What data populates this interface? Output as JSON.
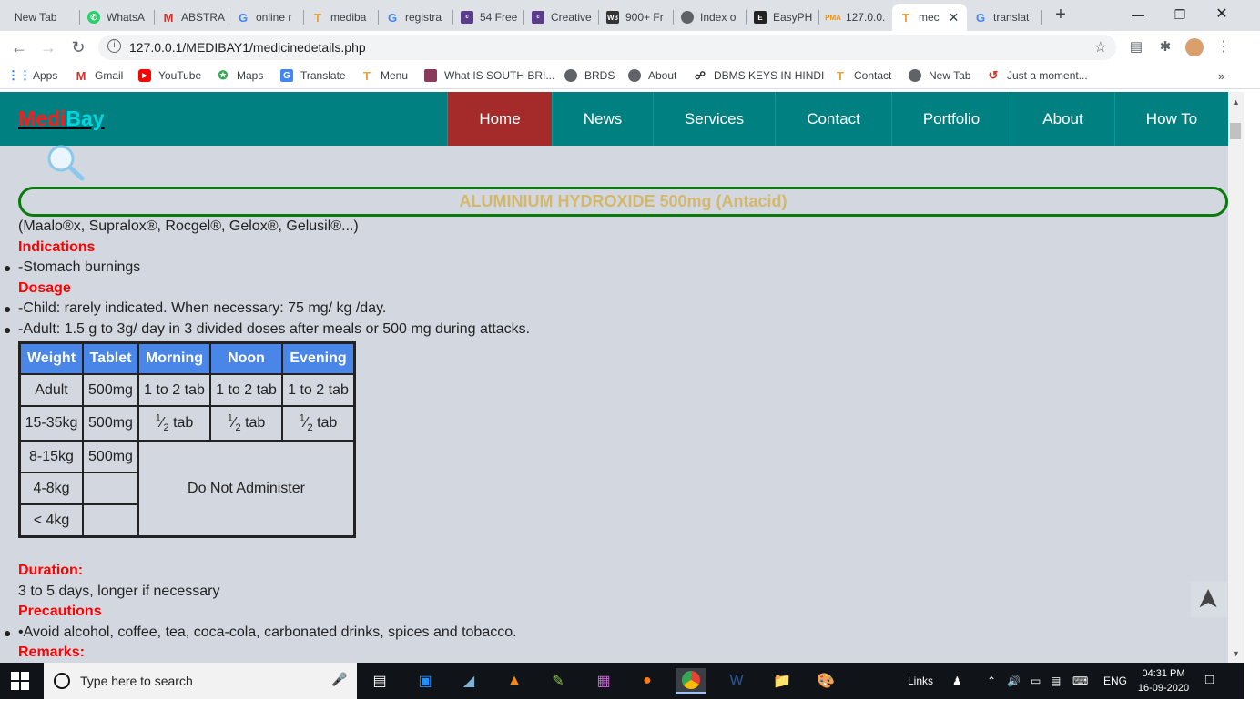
{
  "browser": {
    "tabs": [
      {
        "label": "New Tab",
        "icon": "none",
        "color": "#dee1e6"
      },
      {
        "label": "WhatsA",
        "icon": "whatsapp-icon",
        "color": "#25d366"
      },
      {
        "label": "ABSTRA",
        "icon": "gmail-icon",
        "color": "#d93025"
      },
      {
        "label": "online r",
        "icon": "google-icon",
        "color": "#4285f4"
      },
      {
        "label": "mediba",
        "icon": "medibay-icon",
        "color": "#e8a33d"
      },
      {
        "label": "registra",
        "icon": "google-icon",
        "color": "#4285f4"
      },
      {
        "label": "54 Free",
        "icon": "colorlib-icon",
        "color": "#5b3c8a"
      },
      {
        "label": "Creative",
        "icon": "colorlib-icon",
        "color": "#5b3c8a"
      },
      {
        "label": "900+ Fr",
        "icon": "w3-icon",
        "color": "#333"
      },
      {
        "label": "Index o",
        "icon": "globe-icon",
        "color": "#5f6368"
      },
      {
        "label": "EasyPH",
        "icon": "easyphp-icon",
        "color": "#222"
      },
      {
        "label": "127.0.0.",
        "icon": "pma-icon",
        "color": "#f29111"
      },
      {
        "label": "mec",
        "icon": "medibay-icon",
        "color": "#e8a33d"
      },
      {
        "label": "translat",
        "icon": "google-icon",
        "color": "#4285f4"
      }
    ],
    "new_tab_symbol": "+",
    "close_symbol": "✕",
    "url": "127.0.0.1/MEDIBAY1/medicinedetails.php",
    "bookmarks": [
      {
        "label": "Apps",
        "icon": "apps-grid-icon"
      },
      {
        "label": "Gmail",
        "icon": "gmail-icon"
      },
      {
        "label": "YouTube",
        "icon": "youtube-icon"
      },
      {
        "label": "Maps",
        "icon": "maps-icon"
      },
      {
        "label": "Translate",
        "icon": "translate-icon"
      },
      {
        "label": "Menu",
        "icon": "medibay-icon"
      },
      {
        "label": "What IS SOUTH BRI...",
        "icon": "page-icon"
      },
      {
        "label": "BRDS",
        "icon": "globe-icon"
      },
      {
        "label": "About",
        "icon": "globe-icon"
      },
      {
        "label": "DBMS KEYS IN HINDI",
        "icon": "page-icon"
      },
      {
        "label": "Contact",
        "icon": "medibay-icon"
      },
      {
        "label": "New Tab",
        "icon": "globe-icon"
      },
      {
        "label": "Just a moment...",
        "icon": "cloudflare-icon"
      }
    ],
    "bookmarks_overflow": "»"
  },
  "site": {
    "logo_part1": "Medi",
    "logo_part2": "Bay",
    "nav": [
      "Home",
      "News",
      "Services",
      "Contact",
      "Portfolio",
      "About",
      "How To"
    ],
    "active_nav": "Home",
    "colors": {
      "nav_bg": "#008080",
      "active_bg": "#a52a2a",
      "heading_red": "#ff0000",
      "table_header": "#4a86e8",
      "title_gold": "#d4b86a",
      "title_border": "#0a7a0a"
    }
  },
  "medicine": {
    "title": "ALUMINIUM HYDROXIDE 500mg (Antacid)",
    "brands": "(Maalo®x, Supralox®, Rocgel®, Gelox®, Gelusil®...)",
    "indications_heading": "Indications",
    "indications": [
      "-Stomach burnings"
    ],
    "dosage_heading": "Dosage",
    "dosage": [
      "-Child: rarely indicated. When necessary: 75 mg/ kg /day.",
      "-Adult: 1.5 g to 3g/ day in 3 divided doses after meals or 500 mg during attacks."
    ],
    "table": {
      "headers": [
        "Weight",
        "Tablet",
        "Morning",
        "Noon",
        "Evening"
      ],
      "row_adult": [
        "Adult",
        "500mg",
        "1 to 2 tab",
        "1 to 2 tab",
        "1 to 2 tab"
      ],
      "row_15_35": [
        "15-35kg",
        "500mg",
        "tab",
        "tab",
        "tab"
      ],
      "fraction_num": "1",
      "fraction_den": "2",
      "row_8_15": [
        "8-15kg",
        "500mg"
      ],
      "row_4_8": [
        "4-8kg",
        ""
      ],
      "row_lt4": [
        "< 4kg",
        ""
      ],
      "do_not_administer": "Do Not Administer"
    },
    "duration_heading": "Duration:",
    "duration": "3 to 5 days, longer if necessary",
    "precautions_heading": "Precautions",
    "precautions": [
      "•Avoid alcohol, coffee, tea, coca-cola, carbonated drinks, spices and tobacco."
    ],
    "remarks_heading": "Remarks:"
  },
  "taskbar": {
    "search_placeholder": "Type here to search",
    "links": "Links",
    "language": "ENG",
    "time": "04:31 PM",
    "date": "16-09-2020"
  },
  "scroll_to_top_symbol": "➤"
}
